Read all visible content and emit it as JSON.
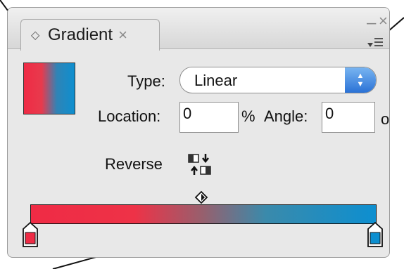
{
  "panel": {
    "tab_label": "Gradient",
    "tab_close": "×",
    "tab_arrows": "◇",
    "window_minimize": "–",
    "window_close": "×"
  },
  "type": {
    "label": "Type:",
    "value": "Linear"
  },
  "location": {
    "label": "Location:",
    "value": "0",
    "unit": "%"
  },
  "angle": {
    "label": "Angle:",
    "value": "0",
    "unit": "o"
  },
  "reverse": {
    "label": "Reverse"
  },
  "gradient": {
    "start_color": "#ef2b45",
    "end_color": "#0d8fd0"
  }
}
